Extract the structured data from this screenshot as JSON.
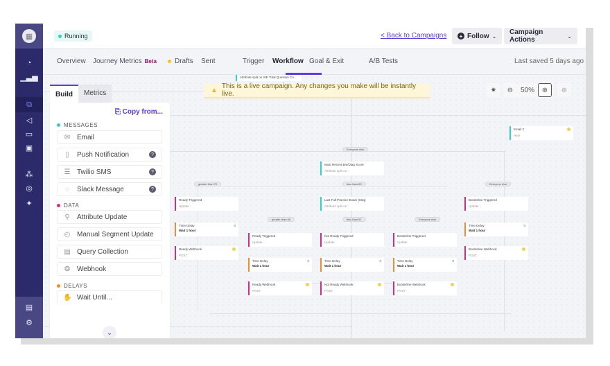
{
  "header": {
    "status": "Running",
    "status_color": "#2fd3c6",
    "back_link": "< Back to Campaigns",
    "follow_label": "Follow",
    "campaign_actions_label": "Campaign Actions"
  },
  "subnav": {
    "tabs": [
      {
        "label": "Overview"
      },
      {
        "label": "Journey Metrics",
        "badge": "Beta"
      },
      {
        "label": "Drafts",
        "dot_color": "#f5c21b"
      },
      {
        "label": "Sent"
      },
      {
        "label": "Trigger"
      },
      {
        "label": "Workflow",
        "active": true
      },
      {
        "label": "Goal & Exit"
      },
      {
        "label": "A/B Tests"
      }
    ],
    "last_saved": "Last saved 5 days ago"
  },
  "banner": {
    "text": "This is a live campaign. Any changes you make will be instantly live.",
    "icon": "warning-icon"
  },
  "zoom": {
    "level": "50%"
  },
  "panel": {
    "tabs": [
      "Build",
      "Metrics"
    ],
    "copy_from": "Copy from...",
    "sections": [
      {
        "title": "MESSAGES",
        "color": "#2fd3c6",
        "items": [
          {
            "label": "Email",
            "icon": "email-icon",
            "help": false
          },
          {
            "label": "Push Notification",
            "icon": "phone-icon",
            "help": true
          },
          {
            "label": "Twilio SMS",
            "icon": "chat-icon",
            "help": true
          },
          {
            "label": "Slack Message",
            "icon": "chat-icon",
            "help": true
          }
        ]
      },
      {
        "title": "DATA",
        "color": "#e0287a",
        "items": [
          {
            "label": "Attribute Update",
            "icon": "attribute-icon"
          },
          {
            "label": "Manual Segment Update",
            "icon": "segment-icon"
          },
          {
            "label": "Query Collection",
            "icon": "collection-icon"
          },
          {
            "label": "Webhook",
            "icon": "webhook-icon"
          }
        ]
      },
      {
        "title": "DELAYS",
        "color": "#f08c2a",
        "items": [
          {
            "label": "Wait Until...",
            "icon": "hand-icon"
          }
        ]
      }
    ]
  },
  "workflow": {
    "top_node": "Attribute split on SIE Total Question Co...",
    "pills": [
      "Everyone else",
      "greater than 70",
      "less than 63",
      "Everyone else",
      "greater than 66",
      "less than 61",
      "Everyone else"
    ],
    "nodes": [
      {
        "title": "Email 2",
        "sub": "Hey!"
      },
      {
        "title": "Most Recent Bm/Diag Score",
        "sub": "Attribute split on :"
      },
      {
        "title": "Ready Triggered",
        "sub": "Update :"
      },
      {
        "title": "Last Full Practice Exam (6Sq)",
        "sub": "Attribute split on :"
      },
      {
        "title": "Borderline Triggered",
        "sub": "Update :"
      },
      {
        "title": "Time Delay",
        "sub": "Wait 1 hour",
        "count": "0"
      },
      {
        "title": "Ready Webhook",
        "sub": "POST :"
      },
      {
        "title": "Ready Triggered",
        "sub": "Update :"
      },
      {
        "title": "Not Ready Triggered",
        "sub": "Update"
      },
      {
        "title": "Borderline Triggered",
        "sub": "Update"
      },
      {
        "title": "Time Delay",
        "sub": "Wait 1 hour",
        "count": "0"
      },
      {
        "title": "Time Delay",
        "sub": "Wait 1 hour",
        "count": "0"
      },
      {
        "title": "Time Delay",
        "sub": "Wait 1 hour",
        "count": "0"
      },
      {
        "title": "Ready Webhook",
        "sub": "POST :"
      },
      {
        "title": "Not Ready Webhook",
        "sub": "POST :"
      },
      {
        "title": "Borderline Webhook",
        "sub": "POST :"
      },
      {
        "title": "Time Delay",
        "sub": "Wait 1 hour",
        "count": "0"
      },
      {
        "title": "Borderline Webhook",
        "sub": "POST :"
      }
    ]
  }
}
